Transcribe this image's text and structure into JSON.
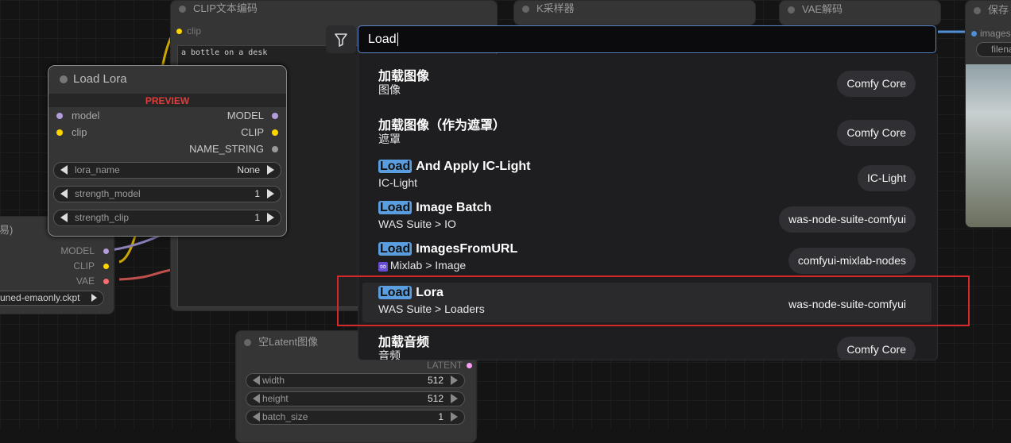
{
  "search": {
    "query": "Load"
  },
  "results": [
    {
      "highlight": "",
      "name": "加载图像",
      "category": "图像",
      "badge": "Comfy Core",
      "category_icon": ""
    },
    {
      "highlight": "",
      "name": "加载图像（作为遮罩）",
      "category": "遮罩",
      "badge": "Comfy Core",
      "category_icon": ""
    },
    {
      "highlight": "Load",
      "name": "And Apply IC-Light",
      "category": "IC-Light",
      "badge": "IC-Light",
      "category_icon": ""
    },
    {
      "highlight": "Load",
      "name": "Image Batch",
      "category": "WAS Suite > IO",
      "badge": "was-node-suite-comfyui",
      "category_icon": ""
    },
    {
      "highlight": "Load",
      "name": "ImagesFromURL",
      "category": "Mixlab > Image",
      "badge": "comfyui-mixlab-nodes",
      "category_icon": "∞"
    },
    {
      "highlight": "Load",
      "name": "Lora",
      "category": "WAS Suite > Loaders",
      "badge": "was-node-suite-comfyui",
      "category_icon": ""
    },
    {
      "highlight": "",
      "name": "加载音频",
      "category": "音频",
      "badge": "Comfy Core",
      "category_icon": ""
    }
  ],
  "lora_node": {
    "title": "Load Lora",
    "preview": "PREVIEW",
    "inputs": [
      "model",
      "clip"
    ],
    "outputs": [
      "MODEL",
      "CLIP",
      "NAME_STRING"
    ],
    "widgets": [
      {
        "label": "lora_name",
        "value": "None"
      },
      {
        "label": "strength_model",
        "value": "1"
      },
      {
        "label": "strength_clip",
        "value": "1"
      }
    ]
  },
  "clip_node": {
    "title": "CLIP文本编码",
    "input": "clip",
    "text": "a bottle on a desk"
  },
  "ksampler_node": {
    "title": "K采样器"
  },
  "vae_node": {
    "title": "VAE解码"
  },
  "save_node": {
    "title": "保存",
    "input": "images",
    "widget": "filena"
  },
  "checkpoint_node": {
    "title_fragment": "易)",
    "outputs": [
      "MODEL",
      "CLIP",
      "VAE"
    ],
    "ckpt": "uned-emaonly.ckpt"
  },
  "latent_node": {
    "title": "空Latent图像",
    "output": "LATENT",
    "widgets": [
      {
        "label": "width",
        "value": "512"
      },
      {
        "label": "height",
        "value": "512"
      },
      {
        "label": "batch_size",
        "value": "1"
      }
    ]
  },
  "colors": {
    "accent": "#5b9ee0",
    "selection_box": "#d62828",
    "model": "#b39ddb",
    "clip": "#ffd500",
    "vae": "#ff6e6e",
    "latent": "#ff9cf9"
  }
}
